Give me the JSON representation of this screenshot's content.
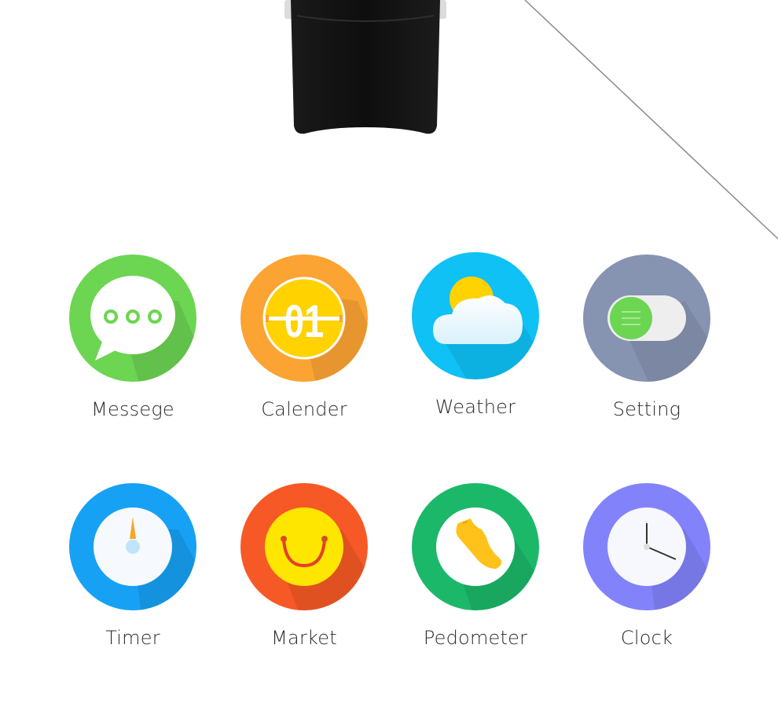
{
  "apps": [
    {
      "label": "Messege",
      "icon": "message-bubble-icon",
      "color": "#6cd552"
    },
    {
      "label": "Calender",
      "icon": "calendar-icon",
      "color": "#fba333",
      "day": "01"
    },
    {
      "label": "Weather",
      "icon": "weather-sun-cloud-icon",
      "color": "#0fc1f5"
    },
    {
      "label": "Setting",
      "icon": "toggle-switch-icon",
      "color": "#8693b1"
    },
    {
      "label": "Timer",
      "icon": "stopwatch-icon",
      "color": "#17a1f5"
    },
    {
      "label": "Market",
      "icon": "smiley-bag-icon",
      "color": "#f75926"
    },
    {
      "label": "Pedometer",
      "icon": "running-shoe-icon",
      "color": "#1cb86a"
    },
    {
      "label": "Clock",
      "icon": "clock-icon",
      "color": "#8283fb"
    }
  ]
}
